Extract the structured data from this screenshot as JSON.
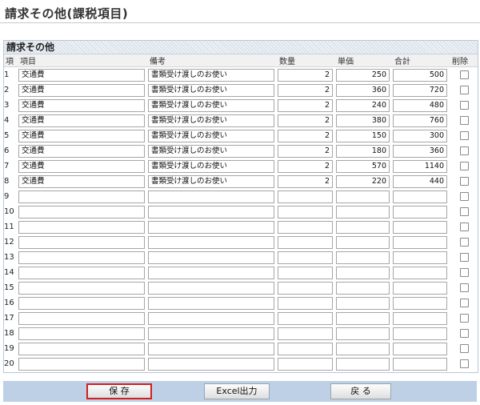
{
  "title": "請求その他(課税項目)",
  "section_title": "請求その他",
  "columns": {
    "no": "項",
    "item": "項目",
    "note": "備考",
    "qty": "数量",
    "unit": "単価",
    "total": "合計",
    "del": "削除"
  },
  "rows": [
    {
      "no": "1",
      "item": "交通費",
      "note": "書類受け渡しのお使い",
      "qty": "2",
      "unit": "250",
      "total": "500"
    },
    {
      "no": "2",
      "item": "交通費",
      "note": "書類受け渡しのお使い",
      "qty": "2",
      "unit": "360",
      "total": "720"
    },
    {
      "no": "3",
      "item": "交通費",
      "note": "書類受け渡しのお使い",
      "qty": "2",
      "unit": "240",
      "total": "480"
    },
    {
      "no": "4",
      "item": "交通費",
      "note": "書類受け渡しのお使い",
      "qty": "2",
      "unit": "380",
      "total": "760"
    },
    {
      "no": "5",
      "item": "交通費",
      "note": "書類受け渡しのお使い",
      "qty": "2",
      "unit": "150",
      "total": "300"
    },
    {
      "no": "6",
      "item": "交通費",
      "note": "書類受け渡しのお使い",
      "qty": "2",
      "unit": "180",
      "total": "360"
    },
    {
      "no": "7",
      "item": "交通費",
      "note": "書類受け渡しのお使い",
      "qty": "2",
      "unit": "570",
      "total": "1140"
    },
    {
      "no": "8",
      "item": "交通費",
      "note": "書類受け渡しのお使い",
      "qty": "2",
      "unit": "220",
      "total": "440"
    },
    {
      "no": "9",
      "item": "",
      "note": "",
      "qty": "",
      "unit": "",
      "total": ""
    },
    {
      "no": "10",
      "item": "",
      "note": "",
      "qty": "",
      "unit": "",
      "total": ""
    },
    {
      "no": "11",
      "item": "",
      "note": "",
      "qty": "",
      "unit": "",
      "total": ""
    },
    {
      "no": "12",
      "item": "",
      "note": "",
      "qty": "",
      "unit": "",
      "total": ""
    },
    {
      "no": "13",
      "item": "",
      "note": "",
      "qty": "",
      "unit": "",
      "total": ""
    },
    {
      "no": "14",
      "item": "",
      "note": "",
      "qty": "",
      "unit": "",
      "total": ""
    },
    {
      "no": "15",
      "item": "",
      "note": "",
      "qty": "",
      "unit": "",
      "total": ""
    },
    {
      "no": "16",
      "item": "",
      "note": "",
      "qty": "",
      "unit": "",
      "total": ""
    },
    {
      "no": "17",
      "item": "",
      "note": "",
      "qty": "",
      "unit": "",
      "total": ""
    },
    {
      "no": "18",
      "item": "",
      "note": "",
      "qty": "",
      "unit": "",
      "total": ""
    },
    {
      "no": "19",
      "item": "",
      "note": "",
      "qty": "",
      "unit": "",
      "total": ""
    },
    {
      "no": "20",
      "item": "",
      "note": "",
      "qty": "",
      "unit": "",
      "total": ""
    }
  ],
  "buttons": {
    "save": "保 存",
    "excel": "Excel出力",
    "back": "戻 る"
  },
  "colors": {
    "footer_bar": "#bdd0e6",
    "highlight": "#d41e1e"
  }
}
